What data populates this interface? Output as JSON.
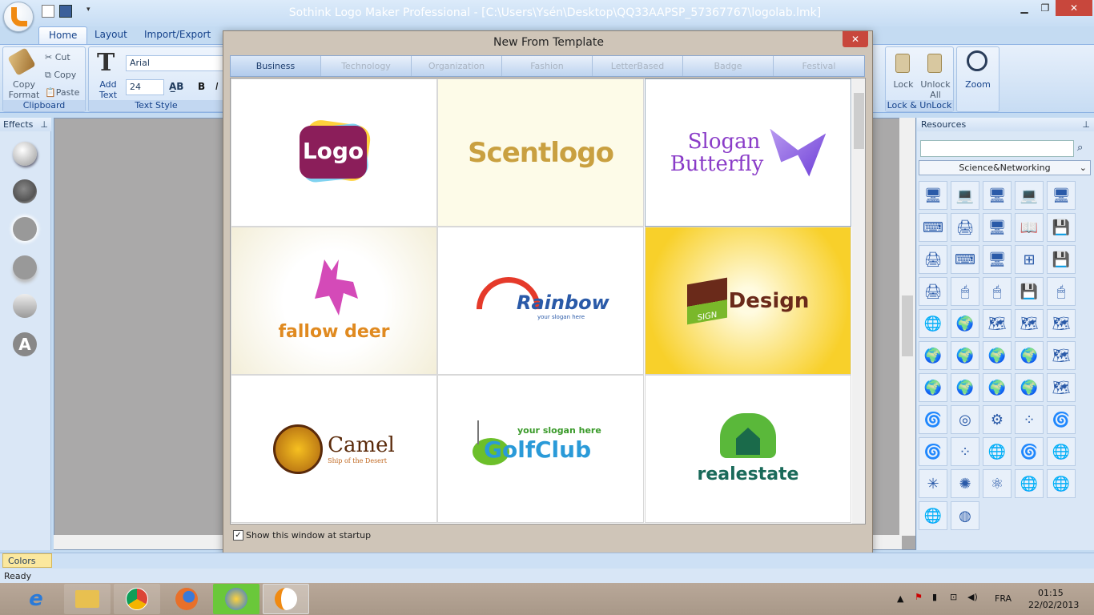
{
  "window": {
    "title": "Sothink Logo Maker Professional - [C:\\Users\\Ysén\\Desktop\\QQ33AAPSP_57367767\\logolab.lmk]",
    "min": "▁",
    "max": "❐",
    "close": "✕"
  },
  "ribbon": {
    "tabs": [
      "Home",
      "Layout",
      "Import/Export"
    ],
    "clipboard": {
      "copy_format": "Copy\nFormat",
      "cut": "Cut",
      "copy": "Copy",
      "paste": "Paste",
      "label": "Clipboard"
    },
    "text": {
      "add_text": "Add\nText",
      "font": "Arial",
      "size": "24",
      "label": "Text Style"
    },
    "lock": {
      "lock": "Lock",
      "unlock_all": "Unlock\nAll",
      "label": "Lock & UnLock"
    },
    "zoom": "Zoom"
  },
  "effects": {
    "title": "Effects"
  },
  "resources": {
    "title": "Resources",
    "search_value": "",
    "category": "Science&Networking"
  },
  "dialog": {
    "title": "New From Template",
    "categories": [
      "Business",
      "Technology",
      "Organization",
      "Fashion",
      "LetterBased",
      "Badge",
      "Festival"
    ],
    "templates": [
      {
        "text": "Logo"
      },
      {
        "text": "Scentlogo"
      },
      {
        "line1": "Slogan",
        "line2": "Butterfly"
      },
      {
        "text": "fallow deer"
      },
      {
        "text": "Rainbow",
        "sub": "your slogan here"
      },
      {
        "text": "SIGN",
        "text2": "Design"
      },
      {
        "text": "Camel",
        "sub": "Ship of the Desert"
      },
      {
        "slogan": "your slogan here",
        "text": "GolfClub"
      },
      {
        "text": "realestate"
      }
    ],
    "startup_label": "Show this window at startup",
    "startup_checked": true
  },
  "colors_tab": "Colors",
  "status": "Ready",
  "tray": {
    "lang": "FRA",
    "time": "01:15",
    "date": "22/02/2013"
  },
  "colors": {
    "accent": "#15428b",
    "ribbon": "#c4dbf2",
    "close": "#c8473c"
  }
}
